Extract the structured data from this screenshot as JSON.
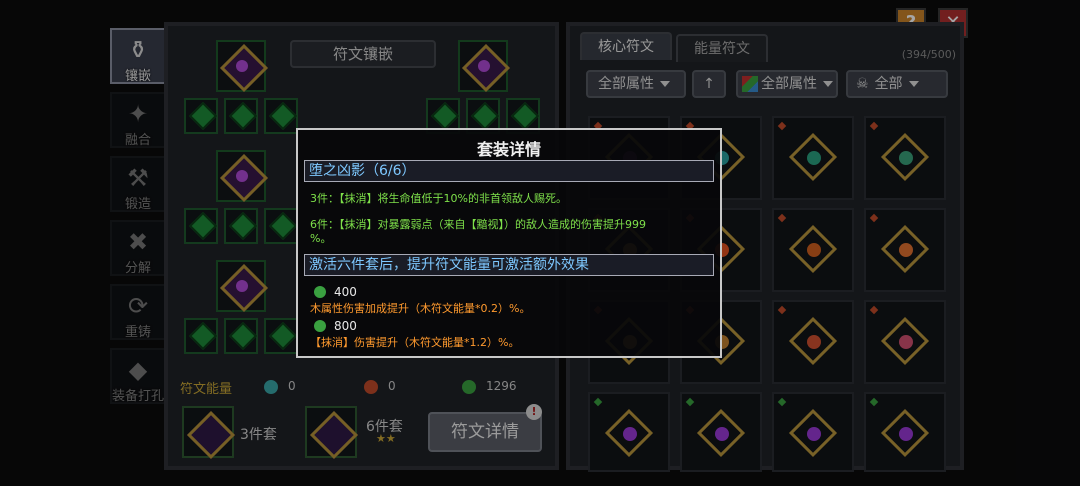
{
  "nav": [
    {
      "label": "镶嵌",
      "glyph": "⚱",
      "active": true
    },
    {
      "label": "融合",
      "glyph": "✦",
      "active": false
    },
    {
      "label": "锻造",
      "glyph": "⚒",
      "active": false
    },
    {
      "label": "分解",
      "glyph": "✖",
      "active": false
    },
    {
      "label": "重铸",
      "glyph": "⟳",
      "active": false
    },
    {
      "label": "装备打孔",
      "glyph": "◆",
      "active": false
    }
  ],
  "topbar": {
    "help_label": "?",
    "close_label": "✕"
  },
  "left_panel": {
    "banner": "符文镶嵌",
    "energy_label": "符文能量",
    "energies": [
      {
        "icon": "water-energy-icon",
        "color": "#3aa6a8",
        "value": "0"
      },
      {
        "icon": "fire-energy-icon",
        "color": "#c04a2a",
        "value": "0"
      },
      {
        "icon": "wood-energy-icon",
        "color": "#3aa040",
        "value": "1296"
      }
    ],
    "set3_label": "3件套",
    "set6_label": "6件套",
    "set6_stars": "★★",
    "detail_button": "符文详情",
    "badge": "!"
  },
  "right_panel": {
    "tabs": [
      "核心符文",
      "能量符文"
    ],
    "count": "(394/500)",
    "filter_attr": "全部属性",
    "sort_icon": "↑",
    "filter_attr2": "全部属性",
    "filter_all": "全部",
    "grid_colors": [
      [
        "#6a3a8a",
        "#2aa0a0",
        "#2aa080",
        "#3aa07a"
      ],
      [
        "#d0a040",
        "#e05020",
        "#d06020",
        "#e07030"
      ],
      [
        "#d0a040",
        "#c08030",
        "#d05030",
        "#d05070"
      ],
      [
        "#9a3ad8",
        "#9a3ad8",
        "#9a3ad8",
        "#9a3ad8"
      ]
    ]
  },
  "popup": {
    "title": "套装详情",
    "set_name": "堕之凶影（6/6）",
    "set3": "3件：【抹消】将生命值低于10%的非首领敌人赐死。",
    "set6_a": "6件：【抹消】对暴露弱点（来自【黯视】）的敌人造成的伤害提升999",
    "set6_b": "%。",
    "extra_header": "激活六件套后，提升符文能量可激活额外效果",
    "tier1_value": "400",
    "tier1_text": "木属性伤害加成提升（木符文能量*0.2）%。",
    "tier2_value": "800",
    "tier2_text": "【抹消】伤害提升（木符文能量*1.2）%。"
  }
}
